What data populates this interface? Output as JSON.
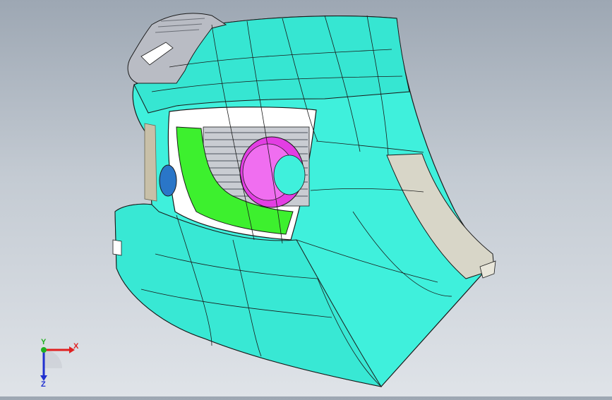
{
  "viewport": {
    "background_top": "#9da7b3",
    "background_bottom": "#dfe3e8"
  },
  "model": {
    "body_color": "#3ff0dc",
    "body_shade": "#2ccbb9",
    "edge_color": "#1a1a1a",
    "trim_color": "#d8d6c8",
    "grille_color": "#a9adb5",
    "green_bezel_color": "#3df02e",
    "ring_color": "#e33ee3",
    "sensor_color": "#2a76c8",
    "housing_color": "#b9bcc4"
  },
  "triad": {
    "x_label": "X",
    "y_label": "Y",
    "z_label": "Z",
    "x_color": "#e02020",
    "y_color": "#20b020",
    "z_color": "#2030d0"
  }
}
